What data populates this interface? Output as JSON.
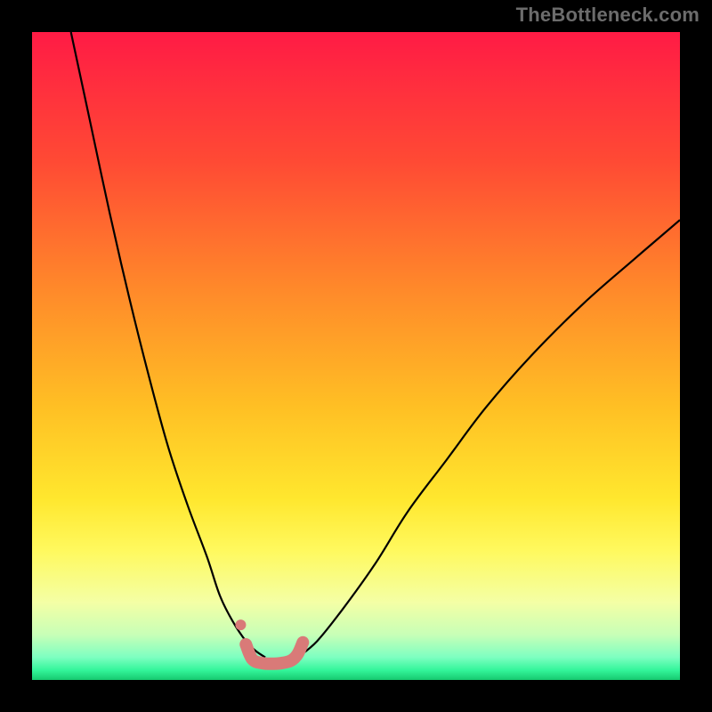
{
  "watermark": "TheBottleneck.com",
  "chart_data": {
    "type": "line",
    "title": "",
    "xlabel": "",
    "ylabel": "",
    "xlim": [
      0,
      100
    ],
    "ylim": [
      0,
      100
    ],
    "grid": false,
    "legend": false,
    "annotations": [],
    "background": {
      "type": "vertical-gradient",
      "description": "Red→orange→yellow near top, fading to green at the very bottom (heatmap-style fill behind the curves)",
      "stops": [
        {
          "pos": 0.0,
          "color": "#ff1b45"
        },
        {
          "pos": 0.2,
          "color": "#ff4a34"
        },
        {
          "pos": 0.4,
          "color": "#ff8a2a"
        },
        {
          "pos": 0.58,
          "color": "#ffc024"
        },
        {
          "pos": 0.72,
          "color": "#ffe72e"
        },
        {
          "pos": 0.8,
          "color": "#fff95e"
        },
        {
          "pos": 0.88,
          "color": "#f4ffa5"
        },
        {
          "pos": 0.93,
          "color": "#c8ffb7"
        },
        {
          "pos": 0.965,
          "color": "#7dffc1"
        },
        {
          "pos": 0.985,
          "color": "#33f59a"
        },
        {
          "pos": 1.0,
          "color": "#16c96f"
        }
      ]
    },
    "series": [
      {
        "name": "left-curve",
        "type": "line",
        "color": "#000000",
        "comment": "Steep descending curve from top-left into the trough. Values are y in the 0–100 space (0 = bottom, 100 = top).",
        "x": [
          6,
          9,
          12,
          15,
          18,
          21,
          24,
          27,
          29,
          31,
          33,
          34.5,
          36
        ],
        "y": [
          100,
          86,
          72,
          59,
          47,
          36,
          27,
          19,
          13,
          9,
          6,
          4.5,
          3.5
        ]
      },
      {
        "name": "right-curve",
        "type": "line",
        "color": "#000000",
        "comment": "Ascending curve from trough toward upper-right.",
        "x": [
          41,
          44,
          48,
          53,
          58,
          64,
          70,
          77,
          85,
          93,
          100
        ],
        "y": [
          3.5,
          6,
          11,
          18,
          26,
          34,
          42,
          50,
          58,
          65,
          71
        ]
      },
      {
        "name": "trough-highlight",
        "type": "line",
        "color": "#d97a78",
        "stroke_width": 14,
        "linecap": "round",
        "comment": "Thick salmon highlight segment at the bottom of the V, with small bumps at each end.",
        "x": [
          33.0,
          34.0,
          35.5,
          37.0,
          38.5,
          40.0,
          41.0,
          41.8
        ],
        "y": [
          5.5,
          3.2,
          2.6,
          2.5,
          2.6,
          3.0,
          4.0,
          5.8
        ]
      },
      {
        "name": "trough-dot",
        "type": "scatter",
        "color": "#d97a78",
        "marker_size": 12,
        "x": [
          32.2
        ],
        "y": [
          8.5
        ]
      }
    ]
  }
}
